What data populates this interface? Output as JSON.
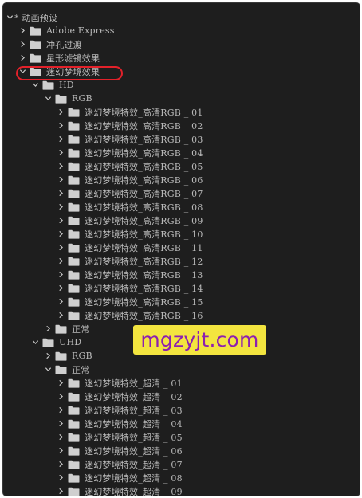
{
  "panel": {
    "root": {
      "label": "* 动画预设",
      "expanded": true
    },
    "items": [
      {
        "label": "Adobe Express",
        "expanded": false
      },
      {
        "label": "冲孔过渡",
        "expanded": false
      },
      {
        "label": "星形滤镜效果",
        "expanded": false
      },
      {
        "label": "迷幻梦境效果",
        "expanded": true,
        "highlighted": true
      },
      {
        "label": "HD",
        "expanded": true
      },
      {
        "label": "RGB",
        "expanded": true
      },
      {
        "label": "迷幻梦境特效_高清RGB _ 01",
        "expanded": false
      },
      {
        "label": "迷幻梦境特效_高清RGB _ 02",
        "expanded": false
      },
      {
        "label": "迷幻梦境特效_高清RGB _ 03",
        "expanded": false
      },
      {
        "label": "迷幻梦境特效_高清RGB _ 04",
        "expanded": false
      },
      {
        "label": "迷幻梦境特效_高清RGB _ 05",
        "expanded": false
      },
      {
        "label": "迷幻梦境特效_高清RGB _ 06",
        "expanded": false
      },
      {
        "label": "迷幻梦境特效_高清RGB _ 07",
        "expanded": false
      },
      {
        "label": "迷幻梦境特效_高清RGB _ 08",
        "expanded": false
      },
      {
        "label": "迷幻梦境特效_高清RGB _ 09",
        "expanded": false
      },
      {
        "label": "迷幻梦境特效_高清RGB _ 10",
        "expanded": false
      },
      {
        "label": "迷幻梦境特效_高清RGB _ 11",
        "expanded": false
      },
      {
        "label": "迷幻梦境特效_高清RGB _ 12",
        "expanded": false
      },
      {
        "label": "迷幻梦境特效_高清RGB _ 13",
        "expanded": false
      },
      {
        "label": "迷幻梦境特效_高清RGB _ 14",
        "expanded": false
      },
      {
        "label": "迷幻梦境特效_高清RGB _ 15",
        "expanded": false
      },
      {
        "label": "迷幻梦境特效_高清RGB _ 16",
        "expanded": false
      },
      {
        "label": "正常",
        "expanded": false
      },
      {
        "label": "UHD",
        "expanded": true
      },
      {
        "label": "RGB",
        "expanded": false
      },
      {
        "label": "正常",
        "expanded": true
      },
      {
        "label": "迷幻梦境特效_超清 _ 01",
        "expanded": false
      },
      {
        "label": "迷幻梦境特效_超清 _ 02",
        "expanded": false
      },
      {
        "label": "迷幻梦境特效_超清 _ 03",
        "expanded": false
      },
      {
        "label": "迷幻梦境特效_超清 _ 04",
        "expanded": false
      },
      {
        "label": "迷幻梦境特效_超清 _ 05",
        "expanded": false
      },
      {
        "label": "迷幻梦境特效_超清 _ 06",
        "expanded": false
      },
      {
        "label": "迷幻梦境特效_超清 _ 07",
        "expanded": false
      },
      {
        "label": "迷幻梦境特效_超清 _ 08",
        "expanded": false
      },
      {
        "label": "迷幻梦境特效_超清 _ 09",
        "expanded": false
      }
    ]
  },
  "watermark": {
    "text": "mgzyjt.com"
  },
  "colors": {
    "panel_bg": "#1e1e1e",
    "text": "#b9b9b9",
    "folder": "#cfcfcf",
    "highlight_ring": "#e3212a",
    "watermark_bg": "#f3e53f",
    "watermark_text": "#8d1fb0"
  },
  "icons": {
    "expanded": "chevron-down-icon",
    "collapsed": "chevron-right-icon",
    "folder": "folder-icon"
  }
}
